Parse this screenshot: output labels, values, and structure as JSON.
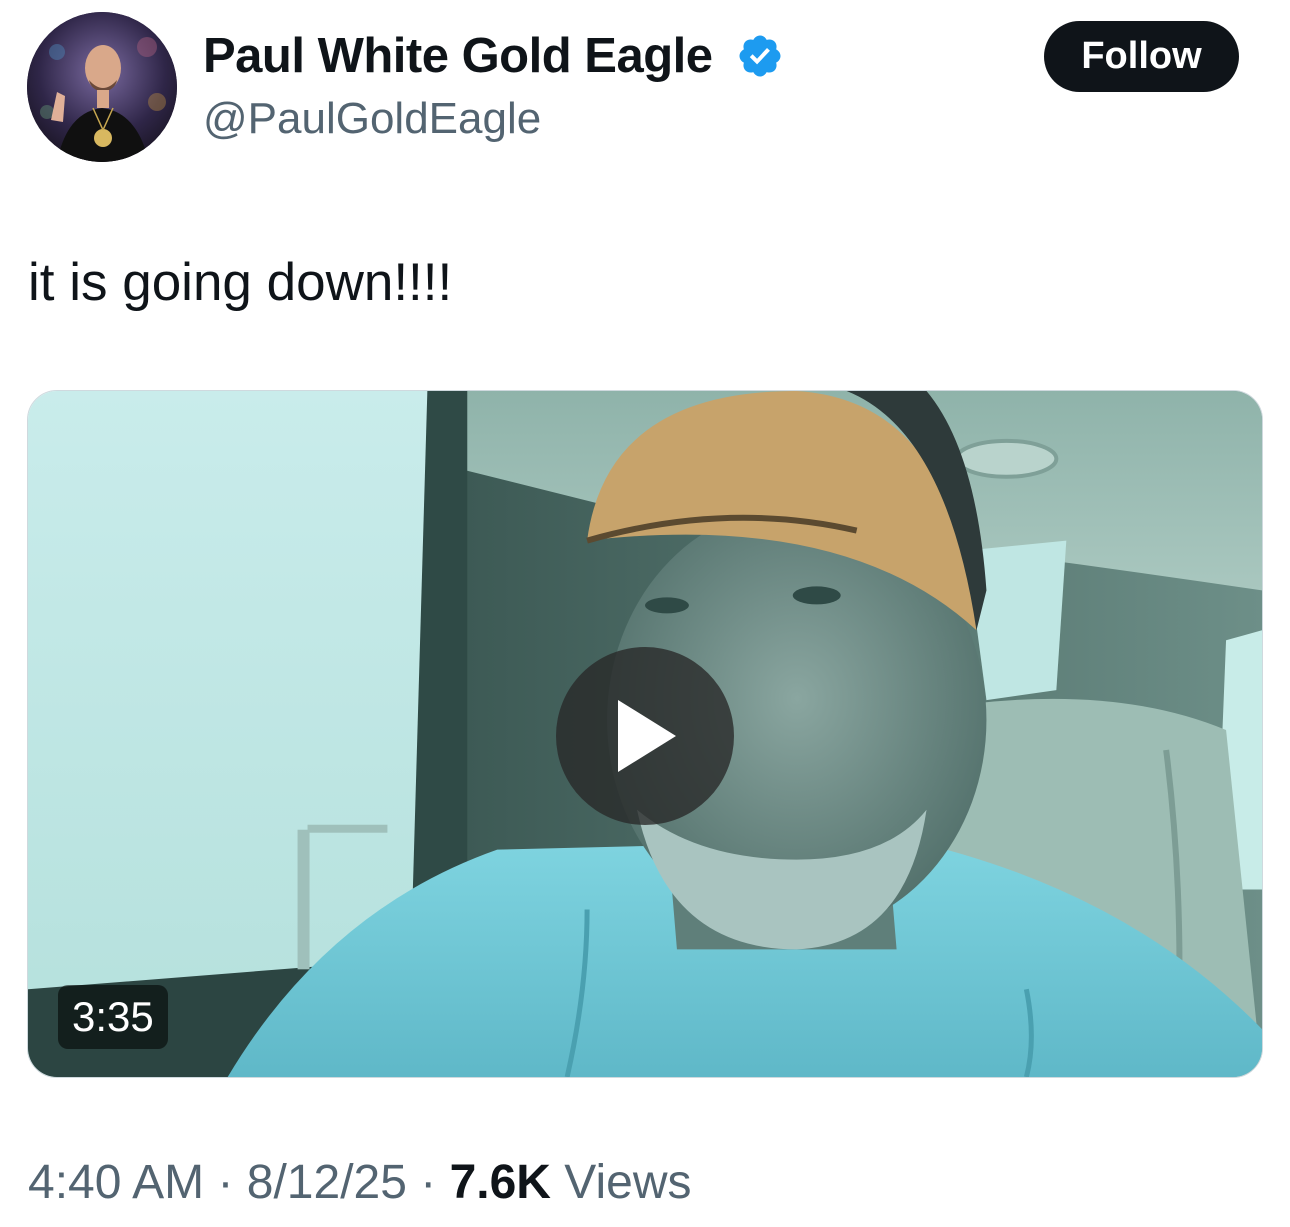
{
  "author": {
    "display_name": "Paul White Gold Eagle",
    "handle": "@PaulGoldEagle",
    "verified_icon": "verified-badge-icon",
    "verified_color": "#1d9bf0"
  },
  "follow_button": {
    "label": "Follow"
  },
  "tweet": {
    "text": "it is going down!!!!"
  },
  "media": {
    "type": "video",
    "duration": "3:35",
    "play_icon": "play-icon"
  },
  "meta": {
    "time": "4:40 AM",
    "sep1": " · ",
    "date": "8/12/25",
    "sep2": " · ",
    "views_count": "7.6K",
    "views_label": " Views"
  },
  "colors": {
    "text_primary": "#0f1419",
    "text_secondary": "#536471",
    "button_bg": "#0f1419"
  }
}
